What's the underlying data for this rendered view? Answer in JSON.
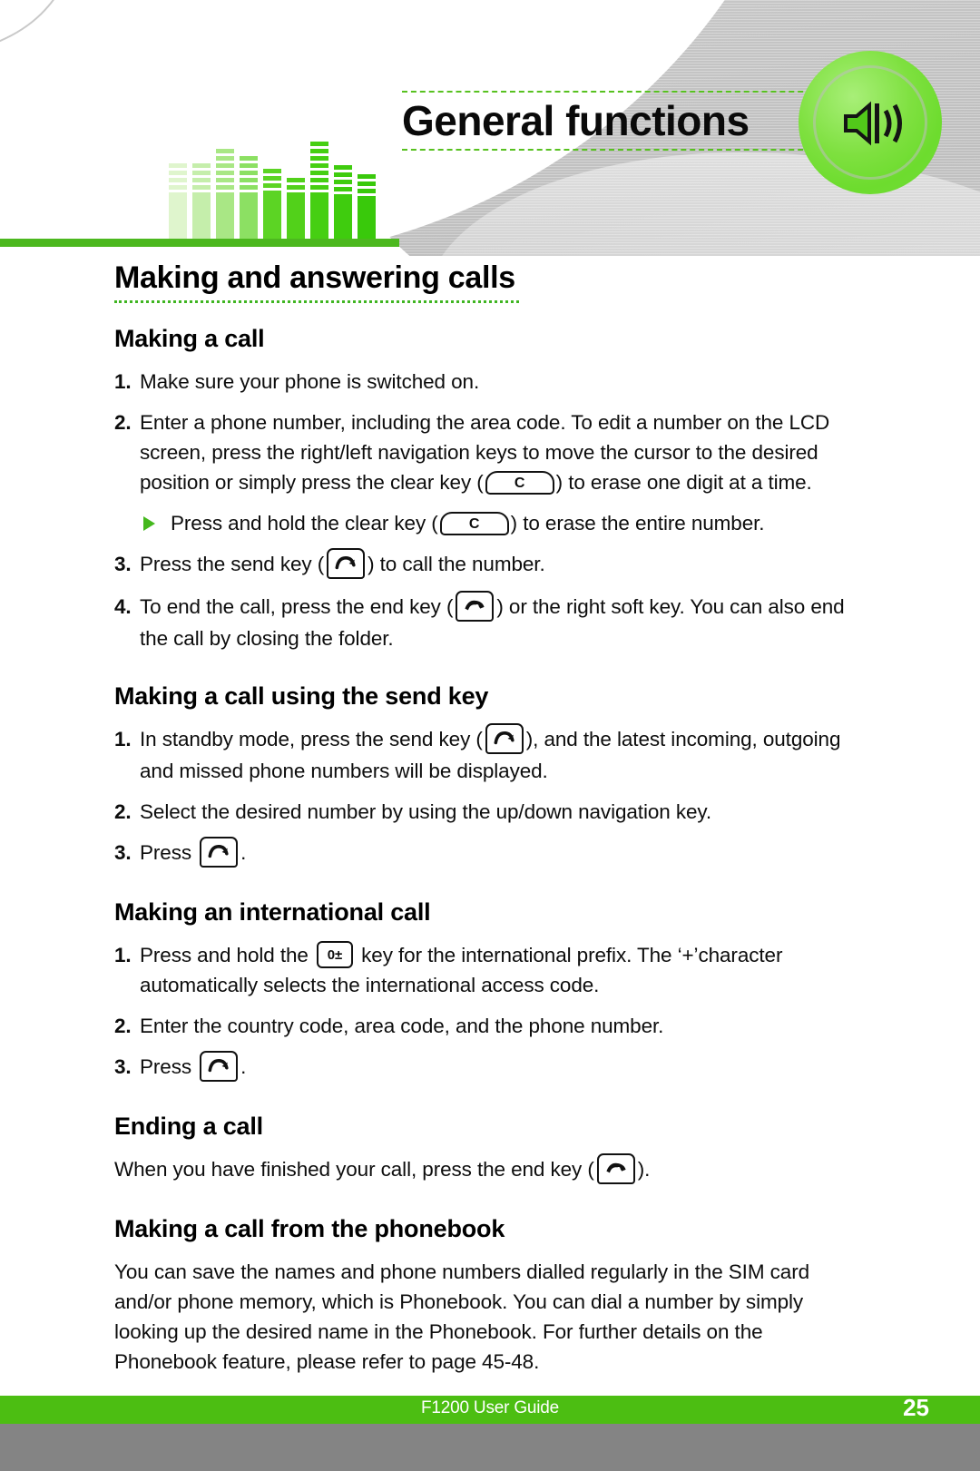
{
  "header": {
    "title": "General functions",
    "speaker_icon_name": "speaker-volume-icon",
    "equalizer": {
      "bars": [
        {
          "segments": 4,
          "body": 52,
          "shade": "#dff5cd"
        },
        {
          "segments": 4,
          "body": 52,
          "shade": "#c5eeab"
        },
        {
          "segments": 6,
          "body": 52,
          "shade": "#a9e785"
        },
        {
          "segments": 5,
          "body": 52,
          "shade": "#8ce063"
        },
        {
          "segments": 3,
          "body": 54,
          "shade": "#5cd424"
        },
        {
          "segments": 2,
          "body": 52,
          "shade": "#52d11a"
        },
        {
          "segments": 7,
          "body": 52,
          "shade": "#46cf12"
        },
        {
          "segments": 4,
          "body": 50,
          "shade": "#3fcc0e"
        },
        {
          "segments": 3,
          "body": 48,
          "shade": "#39c90b"
        }
      ]
    }
  },
  "content": {
    "section_title": "Making and answering calls",
    "blocks": [
      {
        "heading": "Making a call",
        "steps": [
          {
            "num": "1.",
            "parts": [
              {
                "t": "Make sure your phone is switched on."
              }
            ]
          },
          {
            "num": "2.",
            "parts": [
              {
                "t": "Enter a phone number, including the area code. To edit a number on the LCD screen, press the right/left navigation keys to move the cursor to the desired position or simply press the clear key ("
              },
              {
                "key": "clear"
              },
              {
                "t": ") to erase one digit at a time."
              }
            ]
          },
          {
            "bullet": true,
            "parts": [
              {
                "t": "Press and hold the clear key ("
              },
              {
                "key": "clear"
              },
              {
                "t": ") to erase the entire number."
              }
            ]
          },
          {
            "num": "3.",
            "parts": [
              {
                "t": "Press the send key ("
              },
              {
                "key": "send"
              },
              {
                "t": ") to call the number."
              }
            ]
          },
          {
            "num": "4.",
            "parts": [
              {
                "t": "To end the call, press the end key ("
              },
              {
                "key": "end"
              },
              {
                "t": ") or the right soft key. You can also end the call by closing the folder."
              }
            ]
          }
        ]
      },
      {
        "heading": "Making a call using the send key",
        "steps": [
          {
            "num": "1.",
            "parts": [
              {
                "t": "In standby mode, press the send key ("
              },
              {
                "key": "send"
              },
              {
                "t": "), and the latest incoming, outgoing and missed phone numbers will be displayed."
              }
            ]
          },
          {
            "num": "2.",
            "parts": [
              {
                "t": "Select the desired number by using the up/down navigation key."
              }
            ]
          },
          {
            "num": "3.",
            "parts": [
              {
                "t": "Press "
              },
              {
                "key": "send"
              },
              {
                "t": "."
              }
            ]
          }
        ]
      },
      {
        "heading": "Making an international call",
        "steps": [
          {
            "num": "1.",
            "parts": [
              {
                "t": "Press and hold the "
              },
              {
                "key": "zero"
              },
              {
                "t": " key for the international prefix. The ‘+’character automatically selects the international access code."
              }
            ]
          },
          {
            "num": "2.",
            "parts": [
              {
                "t": "Enter the country code, area code, and the phone number."
              }
            ]
          },
          {
            "num": "3.",
            "parts": [
              {
                "t": "Press "
              },
              {
                "key": "send"
              },
              {
                "t": "."
              }
            ]
          }
        ]
      },
      {
        "heading": "Ending a call",
        "paragraph_parts": [
          {
            "t": "When you have finished your call, press the end key ("
          },
          {
            "key": "end"
          },
          {
            "t": ")."
          }
        ]
      },
      {
        "heading": "Making a call from the phonebook",
        "paragraph_parts": [
          {
            "t": "You can save the names and phone numbers dialled regularly in the SIM card and/or phone memory, which is Phonebook. You can dial a number by simply looking up the desired name in the Phonebook. For further details on the Phonebook feature, please refer to page 45-48."
          }
        ]
      }
    ]
  },
  "keys": {
    "clear_label": "C",
    "zero_label": "0±",
    "send_name": "send-call-key-icon",
    "end_name": "end-call-key-icon",
    "clear_name": "clear-key-icon",
    "zero_name": "zero-key-icon"
  },
  "footer": {
    "guide_label": "F1200 User Guide",
    "page_number": "25"
  },
  "colors": {
    "green_accent": "#4cbe12",
    "green_rule": "#4cb81f",
    "green_dot": "#3fb521",
    "grey_bar": "#848484",
    "badge_green": "#7ee03f"
  }
}
